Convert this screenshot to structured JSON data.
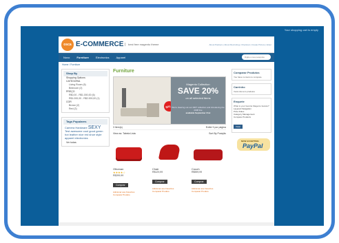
{
  "topbar": {
    "text": "Your shopping cart is empty"
  },
  "header": {
    "brand": "E-COMMERCE",
    "logo": "osca",
    "tagline": "best free magento theme",
    "links": "About Painters | About Recruiting | Checkout | Create Picture | Enter"
  },
  "nav": {
    "items": [
      "Novo",
      "Furniture",
      "Electronics",
      "Apparel"
    ],
    "search_placeholder": "Digite a sua pesquisa"
  },
  "breadcrumb": "Home / Furniture",
  "left": {
    "shop_by": "Shop By",
    "shopping_options": "Shopping Options",
    "category_title": "CATEGORIA",
    "categories": [
      "Living Room (6)",
      "Bedroom (2)"
    ],
    "price_title": "PREÇO",
    "prices": [
      "R$0,00 - R$1.000,00 (6)",
      "R$1.000,00 - R$2.000,00 (1)"
    ],
    "color_title": "COR",
    "colors": [
      "Brown (2)",
      "Red (3)"
    ],
    "tags_title": "Tags Populares",
    "tags": [
      "Camera",
      "Hardware",
      "SEXY",
      "Test",
      "awesome",
      "cool",
      "good",
      "green",
      "hot",
      "leather",
      "nice",
      "red",
      "shoe",
      "style",
      "apparel",
      "electronics"
    ],
    "view_all": "Ver todas"
  },
  "main": {
    "title": "Furniture",
    "banner": {
      "line1": "Magento Collection",
      "line2": "SAVE 20%",
      "line3": "on all selected items",
      "line4": "We're clearing out our 2007 collection and introducing the 2008 line",
      "line5": "available September 21st",
      "sale": "SALE"
    },
    "items_count": "3 Item(s)",
    "show": "Exibir",
    "show_value": "9",
    "per_page": "por página",
    "view_as": "View as: Tabela Lista",
    "sort": "Sort By",
    "sort_value": "Posição"
  },
  "products": [
    {
      "name": "Ottoman",
      "stars": "★★★★☆",
      "price": "R$299,99",
      "button": "Comprar",
      "wishlist": "Adicionar aos Favoritos",
      "compare": "Comparar Produto"
    },
    {
      "name": "Chair",
      "stars": "",
      "price": "R$129,99",
      "button": "Comprar",
      "wishlist": "Adicionar aos Favoritos",
      "compare": "Comparar Produto"
    },
    {
      "name": "Couch",
      "stars": "",
      "price": "R$599,99",
      "button": "Comprar",
      "wishlist": "Adicionar aos Favoritos",
      "compare": "Comparar Produto"
    }
  ],
  "right": {
    "compare_title": "Comparar Produtos",
    "compare_text": "You have no items to compare.",
    "cart_title": "Carrinho",
    "cart_text": "Você não tem produtos",
    "poll_title": "Enquete",
    "poll_question": "What is your favorite Magento feature?",
    "poll_options": [
      "Layered Navigation",
      "Price Rules",
      "Category Management",
      "Compare Products"
    ],
    "vote": "Votar",
    "paypal_top": "NOW ACCEPTING",
    "paypal_logo": "PayPal"
  }
}
